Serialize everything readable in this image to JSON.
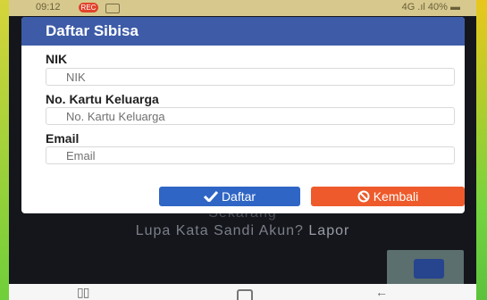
{
  "status_bar": {
    "time": "09:12",
    "notification": "REC",
    "right": "4G  .ıl  40% ▬"
  },
  "dialog": {
    "title": "Daftar Sibisa",
    "fields": [
      {
        "label": "NIK",
        "placeholder": "NIK"
      },
      {
        "label": "No. Kartu Keluarga",
        "placeholder": "No. Kartu Keluarga"
      },
      {
        "label": "Email",
        "placeholder": "Email"
      }
    ],
    "buttons": {
      "daftar": "Daftar",
      "kembali": "Kembali"
    },
    "colors": {
      "header": "#3d5ba7",
      "daftar": "#2f66c5",
      "kembali": "#ee5a2b"
    }
  },
  "background": {
    "line1": "Sekarang",
    "line2_prefix": "Lupa Kata Sandi Akun?",
    "line2_link": "Lapor"
  },
  "nav_bar": {
    "recent": "▯▯",
    "back": "←"
  }
}
